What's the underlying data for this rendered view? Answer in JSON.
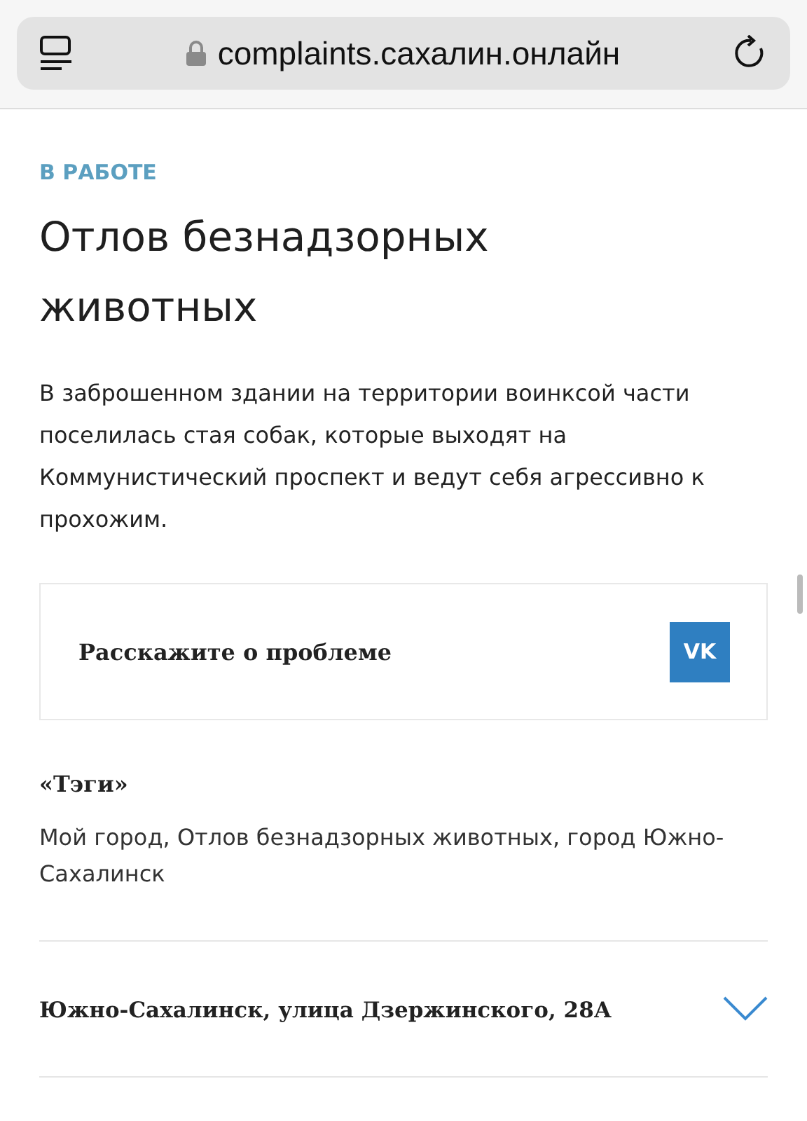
{
  "browser": {
    "url": "complaints.сахалин.онлайн"
  },
  "status": "В РАБОТЕ",
  "title": "Отлов безнадзорных животных",
  "description": "В заброшенном здании на территории воинксой части поселилась стая собак, которые выходят на Коммунистический проспект и ведут себя агрессивно к прохожим.",
  "share": {
    "label": "Расскажите о проблеме",
    "logo": "VK"
  },
  "tags": {
    "title": "«Тэги»",
    "text": "Мой город, Отлов безнадзорных животных, город Южно-Сахалинск"
  },
  "address": {
    "text": "Южно-Сахалинск, улица Дзержинского, 28А",
    "expanded": false
  }
}
